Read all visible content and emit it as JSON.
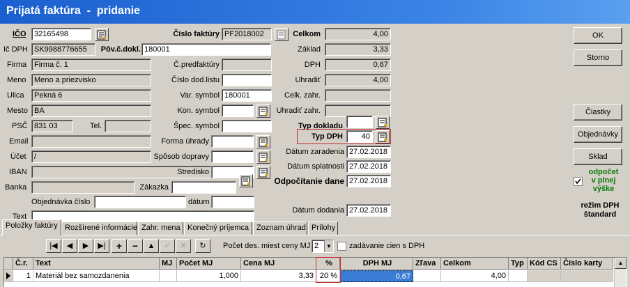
{
  "title": "Prijatá faktúra  -  pridanie",
  "left": {
    "ico_label": "IČO",
    "ico": "32165498",
    "icdph_label": "Ič DPH",
    "icdph": "SK9988776655",
    "firma_label": "Firma",
    "firma": "Firma č. 1",
    "meno_label": "Meno",
    "meno": "Meno a priezvisko",
    "ulica_label": "Ulica",
    "ulica": "Pekná 6",
    "mesto_label": "Mesto",
    "mesto": "BA",
    "psc_label": "PSČ",
    "psc": "831 03",
    "tel_label": "Tel.",
    "tel": "",
    "email_label": "Email",
    "email": "",
    "ucet_label": "Účet",
    "ucet": "/",
    "iban_label": "IBAN",
    "iban": "",
    "banka_label": "Banka",
    "banka": "",
    "objednavka_label": "Objednávka číslo",
    "objednavka": "",
    "text_label": "Text",
    "text": ""
  },
  "middle": {
    "cislo_faktury_label": "Číslo faktúry",
    "cislo_faktury": "PF2018002",
    "pov_c_dokl_label": "Pôv.č.dokl.",
    "pov_c_dokl": "180001",
    "c_predfaktury_label": "Č.predfaktúry",
    "c_predfaktury": "",
    "cislo_dod_listu_label": "Číslo dod.listu",
    "cislo_dod_listu": "",
    "var_symbol_label": "Var. symbol",
    "var_symbol": "180001",
    "kon_symbol_label": "Kon. symbol",
    "kon_symbol": "",
    "spec_symbol_label": "Špec. symbol",
    "spec_symbol": "",
    "forma_uhrady_label": "Forma úhrady",
    "forma_uhrady": "",
    "sposob_dopravy_label": "Spôsob dopravy",
    "sposob_dopravy": "",
    "stredisko_label": "Stredisko",
    "stredisko": "",
    "zakazka_label": "Zákazka",
    "zakazka": "",
    "datum_label": "dátum",
    "datum": ""
  },
  "right": {
    "celkom_label": "Celkom",
    "celkom": "4,00",
    "zaklad_label": "Základ",
    "zaklad": "3,33",
    "dph_label": "DPH",
    "dph": "0,67",
    "uhradit_label": "Uhradiť",
    "uhradit": "4,00",
    "celk_zahr_label": "Celk. zahr.",
    "celk_zahr": "",
    "uhradit_zahr_label": "Uhradiť zahr.",
    "uhradit_zahr": "",
    "typ_dokladu_label": "Typ dokladu",
    "typ_dokladu": "",
    "typ_dph_label": "Typ DPH",
    "typ_dph": "40",
    "datum_zaradenia_label": "Dátum zaradenia",
    "datum_zaradenia": "27.02.2018",
    "datum_splatnosti_label": "Dátum splatnosti",
    "datum_splatnosti": "27.02.2018",
    "odpocitanie_dane_label": "Odpočítanie dane",
    "odpocitanie_dane": "27.02.2018",
    "datum_dodania_label": "Dátum dodania",
    "datum_dodania": "27.02.2018"
  },
  "buttons": {
    "ok": "OK",
    "storno": "Storno",
    "ciastky": "Čiastky",
    "objednavky": "Objednávky",
    "sklad": "Sklad"
  },
  "odpocet": {
    "checked": true,
    "line1": "odpočet",
    "line2": "v plnej",
    "line3": "výške"
  },
  "rezim": {
    "line1": "režim DPH",
    "line2": "štandard"
  },
  "tabs": [
    "Položky faktúry",
    "Rozšírené informácie",
    "Zahr. mena",
    "Konečný príjemca",
    "Zoznam úhrad",
    "Prílohy"
  ],
  "toolbar": {
    "pocet_label": "Počet des. miest ceny MJ",
    "pocet_value": "2",
    "zadavanie_label": "zadávanie cien s DPH"
  },
  "grid": {
    "headers": [
      "Č.r.",
      "Text",
      "MJ",
      "Počet MJ",
      "Cena MJ",
      "%",
      "DPH MJ",
      "Zľava",
      "Celkom",
      "Typ",
      "Kód CS",
      "Číslo karty"
    ],
    "rows": [
      {
        "cr": "1",
        "text": "Materiál bez samozdanenia",
        "mj": "",
        "pocet": "1,000",
        "cena": "3,33",
        "pct": "20 %",
        "dph": "0,67",
        "zlava": "",
        "celkom": "4,00",
        "typ": "",
        "kod": "",
        "karta": ""
      }
    ]
  },
  "colors": {
    "title_bar": "#1a5fcf",
    "highlight": "#c8282a",
    "selected_cell": "#3a7bd5",
    "green_text": "#0a7a0a"
  }
}
